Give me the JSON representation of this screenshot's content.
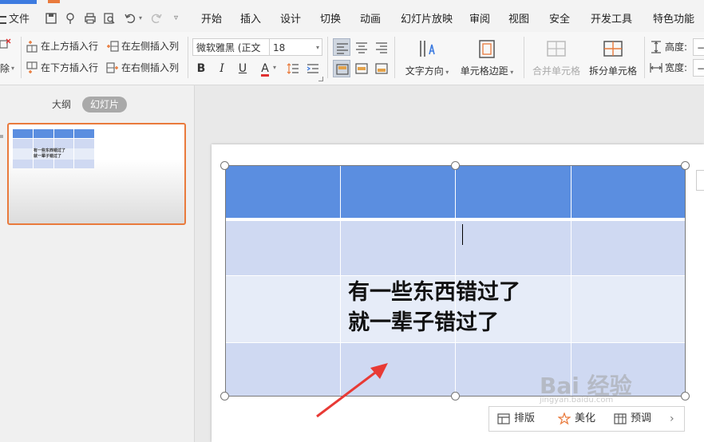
{
  "quick_access": {
    "file_label": "文件"
  },
  "menu_tabs": [
    "开始",
    "插入",
    "设计",
    "切换",
    "动画",
    "幻灯片放映",
    "审阅",
    "视图",
    "安全",
    "开发工具",
    "特色功能"
  ],
  "ribbon": {
    "insert_row_above": "在上方插入行",
    "insert_row_below": "在下方插入行",
    "insert_col_left": "在左侧插入列",
    "insert_col_right": "在右侧插入列",
    "delete_partial": "除",
    "font_name": "微软雅黑 (正文",
    "font_size": "18",
    "bold": "B",
    "italic": "I",
    "underline": "U",
    "font_color": "A",
    "text_direction": "文字方向",
    "cell_margin": "单元格边距",
    "merge_cells": "合并单元格",
    "split_cells": "拆分单元格",
    "height_label": "高度:",
    "width_label": "宽度:"
  },
  "left_panel": {
    "tab_outline": "大纲",
    "tab_slides": "幻灯片"
  },
  "thumbnail": {
    "text_line1": "有一些东西错过了",
    "text_line2": "就一辈子错过了"
  },
  "slide": {
    "cell_text_line1": "有一些东西错过了",
    "cell_text_line2": "就一辈子错过了"
  },
  "float_toolbar": {
    "layout": "排版",
    "beautify": "美化",
    "preview": "预调"
  },
  "watermark": {
    "main": "Bai 经验",
    "sub": "jingyan.baidu.com"
  },
  "colors": {
    "accent": "#e97a3c",
    "table_header": "#5b8ee0",
    "table_row_dark": "#cfd9f2",
    "table_row_light": "#e6ecf8"
  }
}
